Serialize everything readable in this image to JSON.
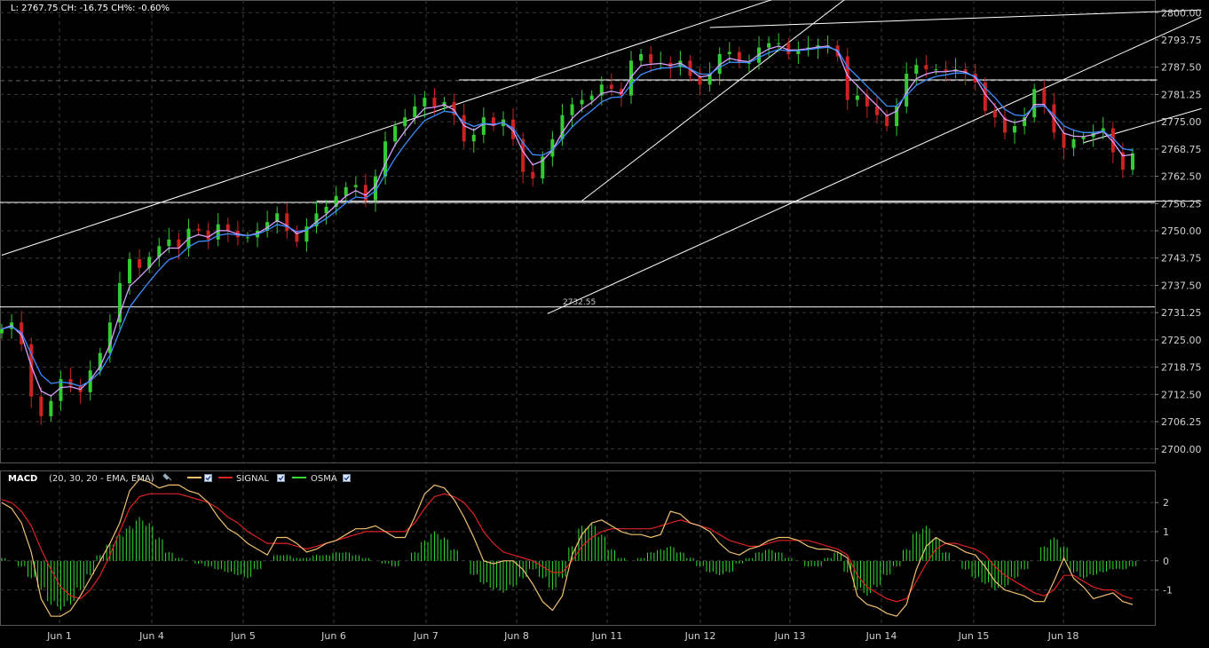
{
  "header": {
    "quote_text": "L: 2767.75 CH: -16.75 CH%: -0.60%"
  },
  "colors": {
    "background": "#000000",
    "grid": "#3a3a3a",
    "up_bar": "#33cc33",
    "down_bar": "#cc2222",
    "ema_fast": "#d8a0ff",
    "ema_slow": "#3d8dff",
    "trendline": "#ffffff",
    "macd_line": "#f0c070",
    "signal_line": "#dd2222",
    "osma_bar": "#33dd33"
  },
  "x_axis": {
    "labels": [
      "Jun 1",
      "Jun 4",
      "Jun 5",
      "Jun 6",
      "Jun 7",
      "Jun 8",
      "Jun 11",
      "Jun 12",
      "Jun 13",
      "Jun 14",
      "Jun 15",
      "Jun 18"
    ]
  },
  "chart_data": [
    {
      "type": "candlestick",
      "title": "",
      "y_ticks": [
        "2800.00",
        "2793.75",
        "2787.50",
        "2781.25",
        "2775.00",
        "2768.75",
        "2762.50",
        "2756.25",
        "2750.00",
        "2743.75",
        "2737.50",
        "2731.25",
        "2725.00",
        "2718.75",
        "2712.50",
        "2706.25",
        "2700.00"
      ],
      "ylim": [
        2696.9,
        2802.9
      ],
      "grid": true,
      "series": [
        {
          "name": "",
          "role": "price",
          "values": [
            2727.5,
            2729.0,
            2724.0,
            2712.0,
            2707.5,
            2711.0,
            2716.0,
            2714.5,
            2713.0,
            2718.0,
            2722.0,
            2729.0,
            2738.0,
            2743.5,
            2741.5,
            2744.0,
            2746.5,
            2748.0,
            2746.0,
            2750.5,
            2750.0,
            2748.0,
            2751.5,
            2750.0,
            2748.5,
            2748.5,
            2750.0,
            2752.0,
            2754.0,
            2750.0,
            2747.5,
            2751.0,
            2754.0,
            2755.5,
            2758.0,
            2760.0,
            2760.5,
            2757.0,
            2762.5,
            2770.5,
            2774.0,
            2776.0,
            2778.5,
            2780.5,
            2778.5,
            2779.5,
            2776.5,
            2770.5,
            2772.0,
            2776.0,
            2774.0,
            2775.5,
            2771.0,
            2763.5,
            2762.0,
            2767.0,
            2771.0,
            2776.5,
            2779.0,
            2780.0,
            2781.0,
            2783.5,
            2782.5,
            2781.0,
            2789.0,
            2790.5,
            2788.5,
            2788.5,
            2787.5,
            2789.0,
            2785.5,
            2783.5,
            2786.0,
            2790.5,
            2791.0,
            2788.5,
            2788.5,
            2792.0,
            2793.0,
            2793.0,
            2790.5,
            2791.5,
            2792.0,
            2792.5,
            2792.5,
            2790.0,
            2780.0,
            2781.0,
            2778.5,
            2776.5,
            2774.0,
            2778.5,
            2786.0,
            2788.0,
            2787.0,
            2787.0,
            2786.5,
            2787.0,
            2786.0,
            2784.0,
            2777.5,
            2776.0,
            2772.5,
            2774.0,
            2776.0,
            2782.5,
            2779.0,
            2772.5,
            2769.0,
            2771.0,
            2771.5,
            2772.5,
            2773.5,
            2768.0,
            2764.0,
            2767.75
          ]
        },
        {
          "name": "",
          "role": "ema-fast"
        },
        {
          "name": "",
          "role": "ema-slow"
        }
      ],
      "horizontal_lines": [
        {
          "value": 2756.5
        },
        {
          "value": 2732.55,
          "label": "2732.55"
        },
        {
          "value": 2784.4,
          "style": "dashed"
        }
      ],
      "trendlines": [
        {
          "x0": 0,
          "y0": 2744.4,
          "x1": 79,
          "y1": 2803.5
        },
        {
          "x0": 59,
          "y0": 2756.9,
          "x1": 86,
          "y1": 2803.5
        },
        {
          "x0": 55.5,
          "y0": 2731.0,
          "x1": 122,
          "y1": 2799.0
        },
        {
          "x0": 72,
          "y0": 2796.6,
          "x1": 122,
          "y1": 2800.6
        },
        {
          "x0": 110,
          "y0": 2770.2,
          "x1": 122,
          "y1": 2778.0
        },
        {
          "x0": 46.5,
          "y0": 2784.6,
          "x1": 117.5,
          "y1": 2784.6
        },
        {
          "x0": 32,
          "y0": 2756.8,
          "x1": 122,
          "y1": 2756.8
        }
      ]
    },
    {
      "type": "line",
      "title": "MACD",
      "params": "(20, 30, 20 - EMA, EMA)",
      "legend": [
        "MACD",
        "SIGNAL",
        "OSMA"
      ],
      "ylim": [
        -2.2,
        3.1
      ],
      "y_ticks": [
        "2",
        "1",
        "0",
        "-1"
      ],
      "series": [
        {
          "name": "MACD",
          "values": [
            2.0,
            1.8,
            1.3,
            0.3,
            -1.3,
            -1.9,
            -1.9,
            -1.7,
            -1.2,
            -0.6,
            0.0,
            0.6,
            1.3,
            2.4,
            2.8,
            2.7,
            2.5,
            2.6,
            2.6,
            2.4,
            2.3,
            2.0,
            1.5,
            1.1,
            0.9,
            0.6,
            0.4,
            0.2,
            0.8,
            0.8,
            0.6,
            0.3,
            0.4,
            0.6,
            0.7,
            0.9,
            1.1,
            1.1,
            1.2,
            1.0,
            0.8,
            0.8,
            1.5,
            2.3,
            2.6,
            2.5,
            2.1,
            1.5,
            0.8,
            0.0,
            -0.1,
            0.0,
            0.0,
            -0.3,
            -0.8,
            -1.4,
            -1.7,
            -1.2,
            0.2,
            0.9,
            1.3,
            1.4,
            1.2,
            1.0,
            0.9,
            0.9,
            0.8,
            0.9,
            1.7,
            1.6,
            1.3,
            1.2,
            1.0,
            0.6,
            0.3,
            0.2,
            0.4,
            0.5,
            0.7,
            0.8,
            0.8,
            0.7,
            0.5,
            0.4,
            0.4,
            0.3,
            0.1,
            -1.2,
            -1.5,
            -1.6,
            -1.8,
            -1.9,
            -1.5,
            -0.3,
            0.5,
            0.8,
            0.6,
            0.5,
            0.3,
            0.2,
            -0.2,
            -0.7,
            -1.0,
            -1.1,
            -1.2,
            -1.4,
            -1.4,
            -0.7,
            0.1,
            -0.6,
            -0.9,
            -1.3,
            -1.2,
            -1.1,
            -1.4,
            -1.5
          ]
        },
        {
          "name": "SIGNAL",
          "values": [
            2.1,
            2.0,
            1.7,
            1.2,
            0.4,
            -0.3,
            -0.9,
            -1.2,
            -1.3,
            -1.0,
            -0.5,
            0.2,
            1.0,
            1.8,
            2.2,
            2.3,
            2.3,
            2.3,
            2.3,
            2.2,
            2.1,
            2.0,
            1.8,
            1.5,
            1.3,
            1.0,
            0.8,
            0.6,
            0.6,
            0.6,
            0.5,
            0.4,
            0.5,
            0.6,
            0.7,
            0.8,
            0.9,
            1.0,
            1.0,
            1.0,
            1.0,
            1.0,
            1.3,
            1.8,
            2.2,
            2.3,
            2.2,
            2.0,
            1.6,
            1.0,
            0.6,
            0.3,
            0.2,
            0.1,
            0.0,
            -0.2,
            -0.4,
            -0.4,
            0.0,
            0.5,
            0.8,
            1.0,
            1.1,
            1.1,
            1.1,
            1.1,
            1.1,
            1.2,
            1.3,
            1.4,
            1.3,
            1.2,
            1.1,
            0.9,
            0.7,
            0.6,
            0.5,
            0.5,
            0.6,
            0.7,
            0.7,
            0.7,
            0.7,
            0.6,
            0.5,
            0.4,
            0.2,
            -0.5,
            -0.9,
            -1.1,
            -1.3,
            -1.4,
            -1.3,
            -0.7,
            -0.1,
            0.4,
            0.6,
            0.6,
            0.5,
            0.4,
            0.2,
            -0.2,
            -0.5,
            -0.7,
            -0.9,
            -1.1,
            -1.2,
            -1.0,
            -0.5,
            -0.5,
            -0.7,
            -0.9,
            -1.0,
            -1.0,
            -1.2,
            -1.3
          ]
        },
        {
          "name": "OSMA",
          "values": [
            0.1,
            0.0,
            -0.2,
            -0.6,
            -1.0,
            -1.5,
            -1.7,
            -1.5,
            -1.0,
            -0.5,
            0.2,
            0.6,
            0.9,
            1.2,
            1.5,
            1.3,
            0.8,
            0.3,
            0.1,
            0.0,
            -0.1,
            -0.2,
            -0.3,
            -0.4,
            -0.5,
            -0.6,
            -0.3,
            0.0,
            0.2,
            0.2,
            0.1,
            0.1,
            0.2,
            0.2,
            0.3,
            0.3,
            0.2,
            0.1,
            0.0,
            -0.1,
            -0.2,
            0.0,
            0.3,
            0.7,
            1.0,
            0.8,
            0.4,
            0.0,
            -0.5,
            -0.8,
            -1.0,
            -1.1,
            -0.9,
            -0.6,
            -0.3,
            -0.6,
            -1.0,
            -0.6,
            0.5,
            1.2,
            1.3,
            0.9,
            0.4,
            0.1,
            0.0,
            0.1,
            0.3,
            0.4,
            0.5,
            0.3,
            0.1,
            -0.2,
            -0.4,
            -0.5,
            -0.4,
            -0.1,
            0.1,
            0.3,
            0.4,
            0.3,
            0.1,
            0.0,
            -0.2,
            -0.2,
            0.1,
            0.3,
            -0.4,
            -1.0,
            -1.2,
            -0.9,
            -0.5,
            -0.2,
            0.4,
            1.0,
            1.2,
            0.8,
            0.3,
            0.0,
            -0.3,
            -0.6,
            -0.8,
            -1.0,
            -0.9,
            -0.6,
            -0.3,
            0.0,
            0.5,
            0.8,
            0.5,
            -0.4,
            -0.6,
            -0.5,
            -0.4,
            -0.3,
            -0.3,
            -0.2
          ]
        }
      ]
    }
  ]
}
